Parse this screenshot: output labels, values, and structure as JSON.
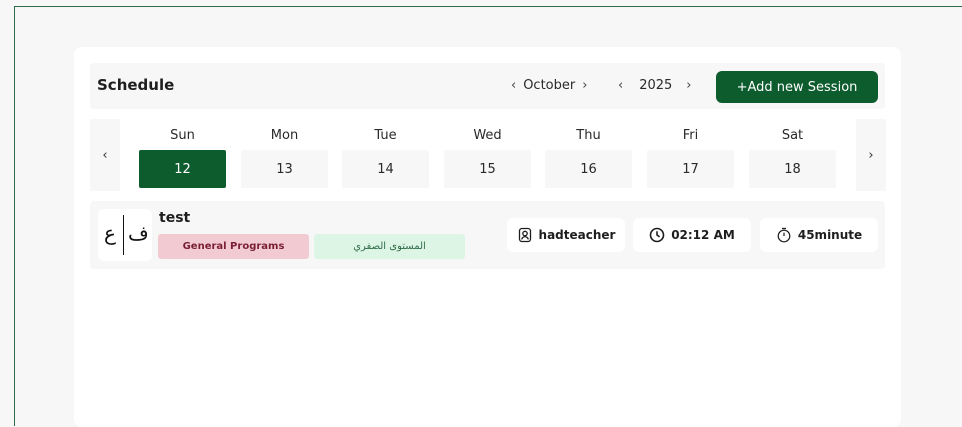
{
  "header": {
    "title": "Schedule",
    "month": "October",
    "year": "2025",
    "prev_symbol": "‹",
    "next_symbol": "›",
    "add_button_label": "+Add new Session"
  },
  "week": {
    "prev_symbol": "‹",
    "next_symbol": "›",
    "days": [
      {
        "name": "Sun",
        "date": "12"
      },
      {
        "name": "Mon",
        "date": "13"
      },
      {
        "name": "Tue",
        "date": "14"
      },
      {
        "name": "Wed",
        "date": "15"
      },
      {
        "name": "Thu",
        "date": "16"
      },
      {
        "name": "Fri",
        "date": "17"
      },
      {
        "name": "Sat",
        "date": "18"
      }
    ],
    "selected_index": 0
  },
  "session": {
    "logo_chars": [
      "ع",
      "ف"
    ],
    "title": "test",
    "program_tag": "General Programs",
    "level_tag": "المستوى الصفري",
    "teacher": "hadteacher",
    "time": "02:12 AM",
    "duration": "45minute",
    "icons": [
      "teacher-badge-icon",
      "clock-icon",
      "timer-icon"
    ]
  },
  "colors": {
    "primary": "#0d5c2e",
    "program_tag_bg": "#f2cbd2",
    "level_tag_bg": "#ddf5e5"
  }
}
